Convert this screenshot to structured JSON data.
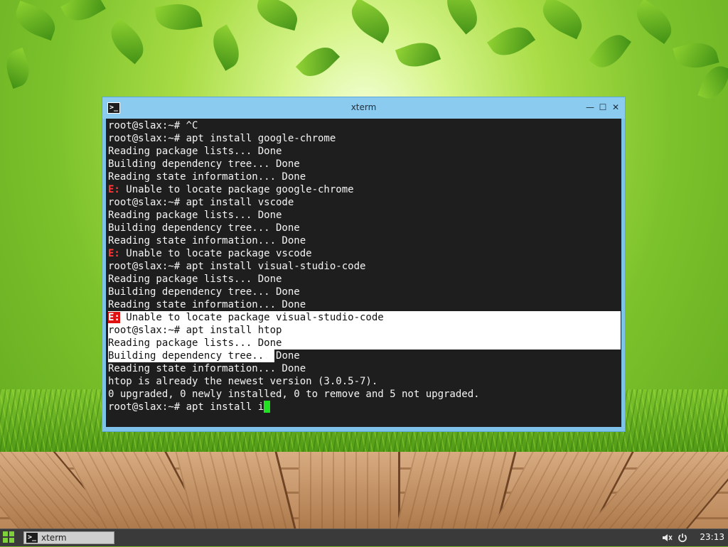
{
  "window": {
    "title": "xterm",
    "icon": "terminal-icon",
    "icon_glyph": ">_",
    "minimize_glyph": "—",
    "maximize_glyph": "☐",
    "close_glyph": "✕"
  },
  "terminal": {
    "lines": [
      {
        "text": "root@slax:~# ^C"
      },
      {
        "text": "root@slax:~# apt install google-chrome"
      },
      {
        "text": "Reading package lists... Done"
      },
      {
        "text": "Building dependency tree... Done"
      },
      {
        "text": "Reading state information... Done"
      },
      {
        "err": "E:",
        "text": " Unable to locate package google-chrome"
      },
      {
        "text": "root@slax:~# apt install vscode"
      },
      {
        "text": "Reading package lists... Done"
      },
      {
        "text": "Building dependency tree... Done"
      },
      {
        "text": "Reading state information... Done"
      },
      {
        "err": "E:",
        "text": " Unable to locate package vscode"
      },
      {
        "text": "root@slax:~# apt install visual-studio-code"
      },
      {
        "text": "Reading package lists... Done"
      },
      {
        "text": "Building dependency tree... Done"
      },
      {
        "text": "Reading state information... Done"
      },
      {
        "err": "E:",
        "text": " Unable to locate package visual-studio-code",
        "selected": "full"
      },
      {
        "text": "root@slax:~# apt install htop",
        "selected": "full"
      },
      {
        "text": "Reading package lists... Done",
        "selected": "full"
      },
      {
        "text": "Building dependency tree... Done",
        "selected": "partial"
      },
      {
        "text": "Reading state information... Done"
      },
      {
        "text": "htop is already the newest version (3.0.5-7)."
      },
      {
        "text": "0 upgraded, 0 newly installed, 0 to remove and 5 not upgraded."
      },
      {
        "text": "root@slax:~# apt install i",
        "cursor": true
      }
    ],
    "colors": {
      "background": "#1e1e1e",
      "foreground": "#f4f4f4",
      "error": "#ff3b3b",
      "cursor": "#22e022",
      "selection": "#ffffff"
    }
  },
  "taskbar": {
    "start_icon": "app-grid-icon",
    "task_label": "xterm",
    "task_icon_glyph": ">_",
    "volume_icon": "volume-muted-icon",
    "power_icon": "power-icon",
    "clock": "23:13"
  }
}
